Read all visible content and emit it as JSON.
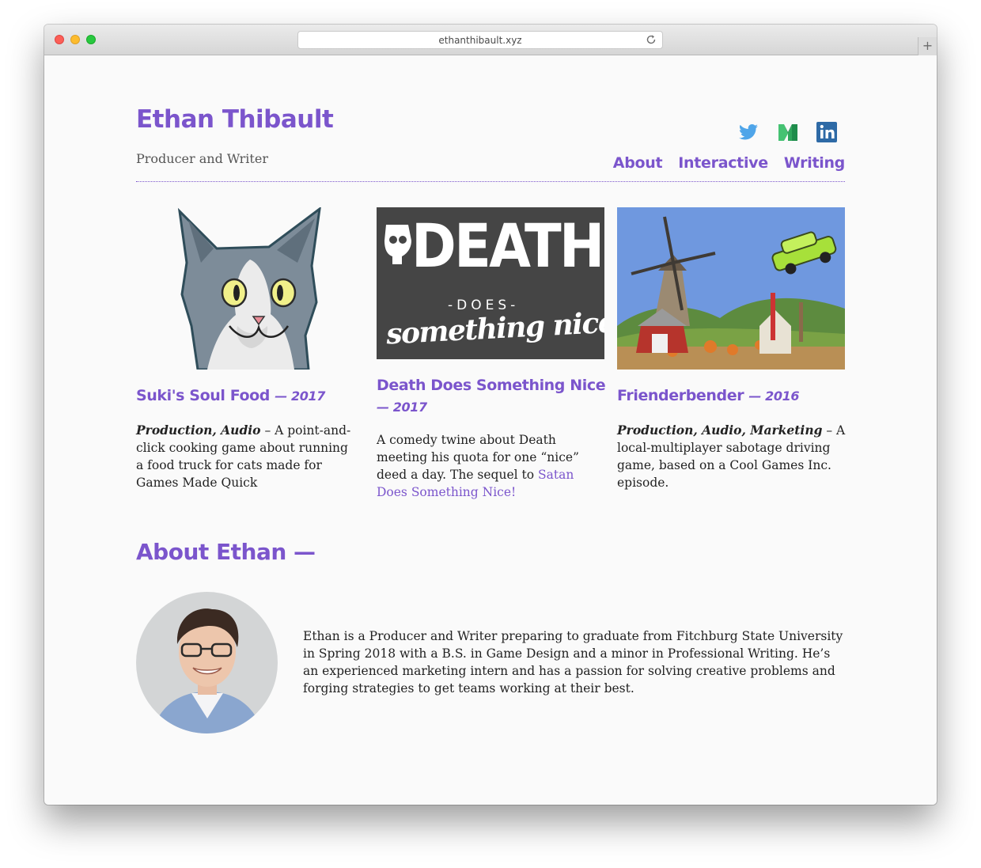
{
  "browser": {
    "url": "ethanthibault.xyz",
    "new_tab_label": "+"
  },
  "header": {
    "title": "Ethan Thibault",
    "subtitle": "Producer and Writer",
    "social_icons": [
      "twitter-icon",
      "medium-icon",
      "linkedin-icon"
    ],
    "nav": [
      "About",
      "Interactive",
      "Writing"
    ]
  },
  "colors": {
    "accent": "#7b55cc",
    "background": "#fafafa",
    "text": "#222222"
  },
  "projects": [
    {
      "title": "Suki's Soul Food",
      "year": "— 2017",
      "roles": "Production, Audio",
      "description": " – A point-and-click cooking game about running a food truck for cats made for Games Made Quick"
    },
    {
      "title": "Death Does Something Nice",
      "year": "— 2017",
      "image_text": {
        "line1": "DEATH",
        "line2": "-DOES-",
        "line3": "something nice"
      },
      "description": "A comedy twine about Death meeting his quota for one “nice” deed a day. The sequel to ",
      "link_text": "Satan Does Something Nice!"
    },
    {
      "title": "Frienderbender",
      "year": "— 2016",
      "roles": "Production, Audio, Marketing",
      "description": " – A local-multiplayer sabotage driving game, based on a Cool Games Inc. episode."
    }
  ],
  "about": {
    "heading": "About Ethan —",
    "bio": "Ethan is a Producer and Writer preparing to graduate from Fitchburg State University in Spring 2018 with a B.S. in Game Design and a minor in Professional Writing. He’s an experienced marketing intern and has a passion for solving creative problems and forging strategies to get teams working at their best."
  }
}
